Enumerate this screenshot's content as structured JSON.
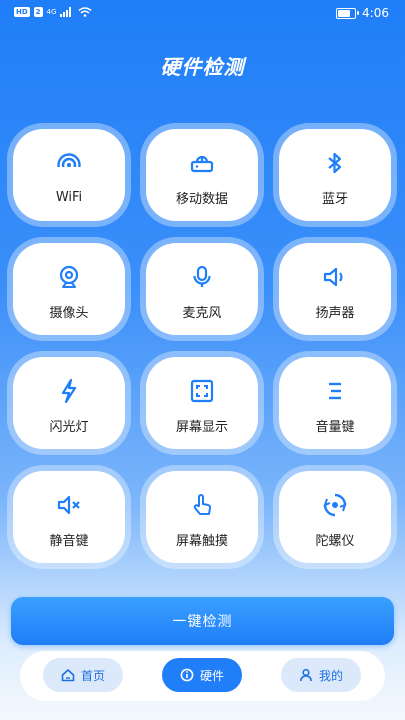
{
  "status_bar": {
    "left_badges": [
      "HD",
      "2"
    ],
    "network": "4G",
    "time": "4:06",
    "battery_level": 0.85
  },
  "header": {
    "title": "硬件检测"
  },
  "colors": {
    "primary": "#1f7ef8",
    "tab_inactive_bg": "#dbe9fb"
  },
  "tiles": [
    {
      "label": "WiFi",
      "icon": "wifi-icon"
    },
    {
      "label": "移动数据",
      "icon": "router-icon"
    },
    {
      "label": "蓝牙",
      "icon": "bluetooth-icon"
    },
    {
      "label": "摄像头",
      "icon": "webcam-icon"
    },
    {
      "label": "麦克风",
      "icon": "microphone-icon"
    },
    {
      "label": "扬声器",
      "icon": "speaker-icon"
    },
    {
      "label": "闪光灯",
      "icon": "flash-icon"
    },
    {
      "label": "屏幕显示",
      "icon": "screen-icon"
    },
    {
      "label": "音量键",
      "icon": "volume-keys-icon"
    },
    {
      "label": "静音键",
      "icon": "mute-icon"
    },
    {
      "label": "屏幕触摸",
      "icon": "touch-icon"
    },
    {
      "label": "陀螺仪",
      "icon": "gyroscope-icon"
    }
  ],
  "actions": {
    "one_key_check": "一键检测"
  },
  "tabbar": {
    "tabs": [
      {
        "label": "首页",
        "icon": "home-icon",
        "active": false
      },
      {
        "label": "硬件",
        "icon": "info-icon",
        "active": true
      },
      {
        "label": "我的",
        "icon": "user-icon",
        "active": false
      }
    ]
  }
}
